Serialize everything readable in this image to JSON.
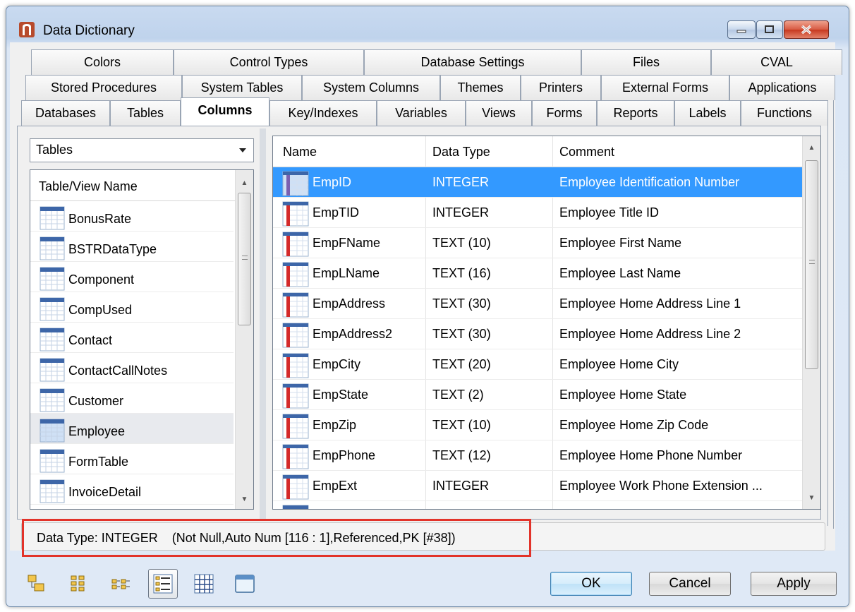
{
  "window": {
    "title": "Data Dictionary"
  },
  "tabs": {
    "row1": [
      "Colors",
      "Control Types",
      "Database Settings",
      "Files",
      "CVAL"
    ],
    "row2": [
      "Stored Procedures",
      "System Tables",
      "System Columns",
      "Themes",
      "Printers",
      "External Forms",
      "Applications"
    ],
    "row3": [
      "Databases",
      "Tables",
      "Columns",
      "Key/Indexes",
      "Variables",
      "Views",
      "Forms",
      "Reports",
      "Labels",
      "Functions"
    ],
    "active": "Columns"
  },
  "left": {
    "combo_value": "Tables",
    "list_header": "Table/View Name",
    "items": [
      "BonusRate",
      "BSTRDataType",
      "Component",
      "CompUsed",
      "Contact",
      "ContactCallNotes",
      "Customer",
      "Employee",
      "FormTable",
      "InvoiceDetail"
    ],
    "selected": "Employee"
  },
  "grid": {
    "headers": [
      "Name",
      "Data Type",
      "Comment"
    ],
    "rows": [
      {
        "name": "EmpID",
        "type": "INTEGER",
        "comment": "Employee Identification Number"
      },
      {
        "name": "EmpTID",
        "type": "INTEGER",
        "comment": "Employee Title ID"
      },
      {
        "name": "EmpFName",
        "type": "TEXT (10)",
        "comment": "Employee First Name"
      },
      {
        "name": "EmpLName",
        "type": "TEXT (16)",
        "comment": "Employee Last Name"
      },
      {
        "name": "EmpAddress",
        "type": "TEXT (30)",
        "comment": "Employee Home Address Line 1"
      },
      {
        "name": "EmpAddress2",
        "type": "TEXT (30)",
        "comment": "Employee Home Address Line 2"
      },
      {
        "name": "EmpCity",
        "type": "TEXT (20)",
        "comment": "Employee Home City"
      },
      {
        "name": "EmpState",
        "type": "TEXT (2)",
        "comment": "Employee Home State"
      },
      {
        "name": "EmpZip",
        "type": "TEXT (10)",
        "comment": "Employee Home Zip Code"
      },
      {
        "name": "EmpPhone",
        "type": "TEXT (12)",
        "comment": "Employee Home Phone Number"
      },
      {
        "name": "EmpExt",
        "type": "INTEGER",
        "comment": "Employee Work Phone Extension ..."
      }
    ],
    "selected": "EmpID"
  },
  "status": {
    "text": "Data Type: INTEGER    (Not Null,Auto Num [116 : 1],Referenced,PK [#38])"
  },
  "buttons": {
    "ok": "OK",
    "cancel": "Cancel",
    "apply": "Apply"
  },
  "colors": {
    "selection": "#3399ff",
    "highlight_box": "#e2332a"
  }
}
